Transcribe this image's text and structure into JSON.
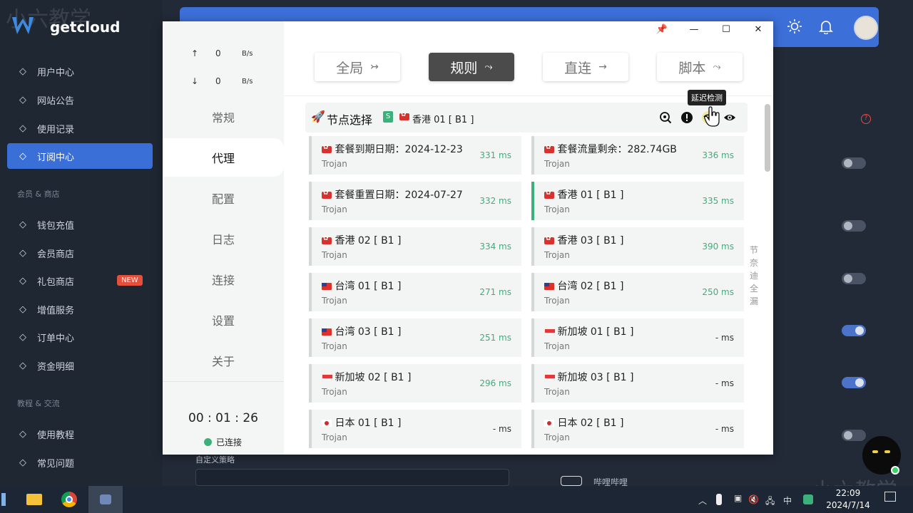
{
  "app": {
    "logo_text": "getcloud",
    "watermark": "小六教学"
  },
  "sidebar": {
    "items": [
      {
        "label": "用户中心",
        "icon": "home-icon"
      },
      {
        "label": "网站公告",
        "icon": "megaphone-icon"
      },
      {
        "label": "使用记录",
        "icon": "user-icon"
      },
      {
        "label": "订阅中心",
        "icon": "cloud-icon",
        "active": true
      }
    ],
    "section_shop": "会员 & 商店",
    "shop_items": [
      {
        "label": "钱包充值",
        "icon": "wallet-icon"
      },
      {
        "label": "会员商店",
        "icon": "cart-icon"
      },
      {
        "label": "礼包商店",
        "icon": "heart-icon",
        "badge": "NEW"
      },
      {
        "label": "增值服务",
        "icon": "grid-icon"
      },
      {
        "label": "订单中心",
        "icon": "receipt-icon"
      },
      {
        "label": "资金明细",
        "icon": "list-icon"
      }
    ],
    "section_help": "教程 & 交流",
    "help_items": [
      {
        "label": "使用教程",
        "icon": "book-icon"
      },
      {
        "label": "常见问题",
        "icon": "question-icon"
      }
    ]
  },
  "background": {
    "custom_policy_label": "自定义策略",
    "bilibili_label": "哔哩哔哩"
  },
  "clash": {
    "traffic": {
      "up_arrow": "↑",
      "up_value": "0",
      "up_unit": "B/s",
      "down_arrow": "↓",
      "down_value": "0",
      "down_unit": "B/s"
    },
    "nav": [
      "常规",
      "代理",
      "配置",
      "日志",
      "连接",
      "设置",
      "关于"
    ],
    "active_nav": "代理",
    "timer": "00 : 01 : 26",
    "status": "已连接",
    "modes": [
      {
        "label": "全局",
        "icon": "↣"
      },
      {
        "label": "规则",
        "icon": "⤳",
        "active": true
      },
      {
        "label": "直连",
        "icon": "→"
      },
      {
        "label": "脚本",
        "icon": "⤳"
      }
    ],
    "group": {
      "title": "节点选择",
      "badge": "S",
      "selected": "香港 01 [ B1 ]",
      "tooltip": "延迟检测"
    },
    "side_text": "节奈迪全漏",
    "proxies": [
      {
        "name": "套餐到期日期：2024-12-23",
        "type": "Trojan",
        "delay": "331 ms",
        "flag": "hk"
      },
      {
        "name": "套餐流量剩余：282.74GB",
        "type": "Trojan",
        "delay": "336 ms",
        "flag": "hk"
      },
      {
        "name": "套餐重置日期：2024-07-27",
        "type": "Trojan",
        "delay": "332 ms",
        "flag": "hk"
      },
      {
        "name": "香港 01 [ B1 ]",
        "type": "Trojan",
        "delay": "335 ms",
        "flag": "hk",
        "selected": true
      },
      {
        "name": "香港 02 [ B1 ]",
        "type": "Trojan",
        "delay": "334 ms",
        "flag": "hk"
      },
      {
        "name": "香港 03 [ B1 ]",
        "type": "Trojan",
        "delay": "390 ms",
        "flag": "hk"
      },
      {
        "name": "台湾 01 [ B1 ]",
        "type": "Trojan",
        "delay": "271 ms",
        "flag": "tw"
      },
      {
        "name": "台湾 02 [ B1 ]",
        "type": "Trojan",
        "delay": "250 ms",
        "flag": "tw"
      },
      {
        "name": "台湾 03 [ B1 ]",
        "type": "Trojan",
        "delay": "251 ms",
        "flag": "tw"
      },
      {
        "name": "新加坡 01 [ B1 ]",
        "type": "Trojan",
        "delay": "- ms",
        "flag": "sg"
      },
      {
        "name": "新加坡 02 [ B1 ]",
        "type": "Trojan",
        "delay": "296 ms",
        "flag": "sg"
      },
      {
        "name": "新加坡 03 [ B1 ]",
        "type": "Trojan",
        "delay": "- ms",
        "flag": "sg"
      },
      {
        "name": "日本 01 [ B1 ]",
        "type": "Trojan",
        "delay": "- ms",
        "flag": "jp"
      },
      {
        "name": "日本 02 [ B1 ]",
        "type": "Trojan",
        "delay": "- ms",
        "flag": "jp"
      }
    ]
  },
  "taskbar": {
    "ime": "中",
    "time": "22:09",
    "date": "2024/7/14"
  },
  "colors": {
    "accent": "#3c6fd8",
    "green": "#3bb07b",
    "new_badge": "#e4503b"
  }
}
